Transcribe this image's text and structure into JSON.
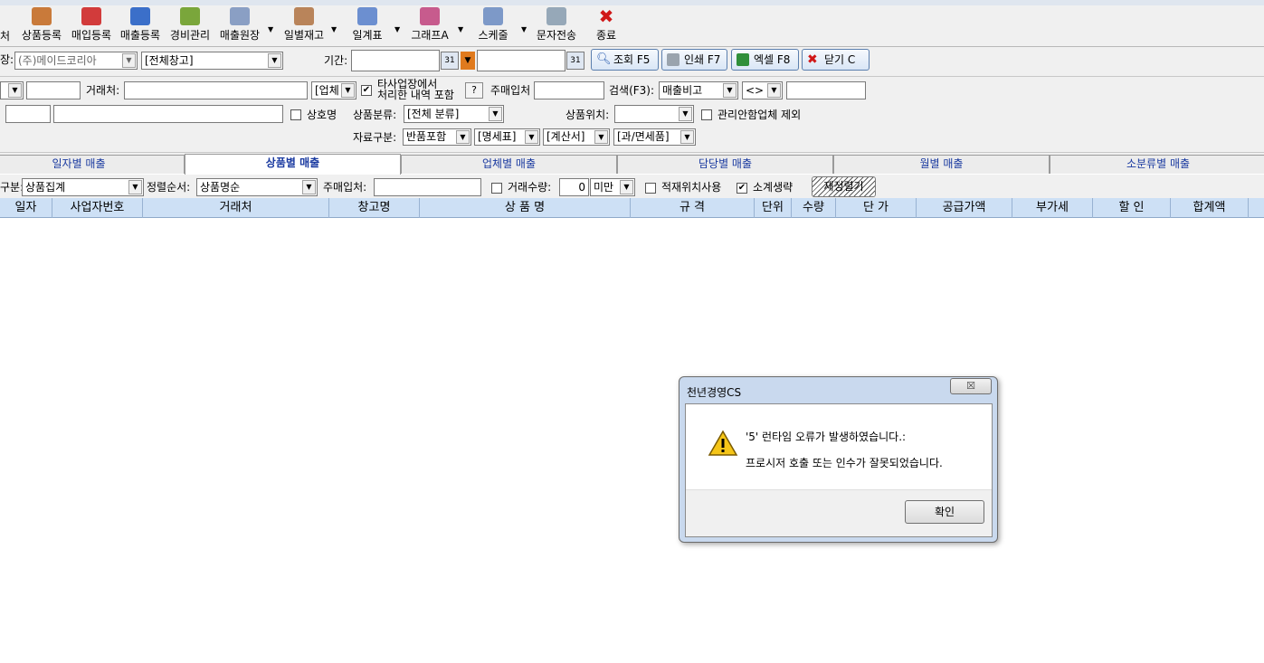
{
  "toolbar": {
    "first_label": "처",
    "items": [
      {
        "label": "상품등록",
        "icon": "box-plus-icon"
      },
      {
        "label": "매입등록",
        "icon": "purchase-icon"
      },
      {
        "label": "매출등록",
        "icon": "sales-icon"
      },
      {
        "label": "경비관리",
        "icon": "coins-icon"
      },
      {
        "label": "매출원장",
        "icon": "ledger-icon"
      },
      {
        "label": "일별재고",
        "icon": "calendar-stock-icon"
      },
      {
        "label": "일계표",
        "icon": "daily-sheet-icon"
      },
      {
        "label": "그래프A",
        "icon": "bar-graph-icon"
      },
      {
        "label": "스케줄",
        "icon": "schedule-icon"
      },
      {
        "label": "문자전송",
        "icon": "sms-icon"
      },
      {
        "label": "종료",
        "icon": "exit-x-icon"
      }
    ]
  },
  "filters": {
    "store_label": "장:",
    "store_value": "(주)메이드코리아",
    "warehouse_value": "[전체창고]",
    "period_label": "기간:",
    "search_button": "조회 F5",
    "print_button": "인쇄 F7",
    "excel_button": "엑셀 F8",
    "close_button": "닫기 C",
    "customer_label": "거래처:",
    "customer_type": "[업체",
    "other_store_line1": "타사업장에서",
    "other_store_line2": "처리한 내역 포함",
    "help_button": "?",
    "main_buyer_label": "주매입처",
    "search_label": "검색(F3):",
    "search_type": "매출비고",
    "search_op": "<>",
    "trade_name_label": "상호명",
    "category_label": "상품분류:",
    "category_value": "[전체 분류]",
    "location_label": "상품위치:",
    "exclude_label": "관리안함업체 제외",
    "data_type_label": "자료구분:",
    "data_type_1": "반품포함",
    "data_type_2": "[명세표]",
    "data_type_3": "[계산서]",
    "data_type_4": "[과/면세품]"
  },
  "tabs": [
    {
      "label": "일자별 매출",
      "active": false
    },
    {
      "label": "상품별 매출",
      "active": true
    },
    {
      "label": "업체별 매출",
      "active": false
    },
    {
      "label": "담당별 매출",
      "active": false
    },
    {
      "label": "월별 매출",
      "active": false
    },
    {
      "label": "소분류별 매출",
      "active": false
    }
  ],
  "subbar": {
    "group_label": "구분:",
    "group_value": "상품집계",
    "sort_label": "정렬순서:",
    "sort_value": "상품명순",
    "main_buyer_label": "주매입처:",
    "qty_label": "거래수량:",
    "qty_value": "0",
    "qty_op": "미만",
    "location_use_label": "적재위치사용",
    "subtotal_label": "소계생략",
    "subtotal_checked": true,
    "rearrange_button": "재정렬기"
  },
  "grid": {
    "columns": [
      "일자",
      "사업자번호",
      "거래처",
      "창고명",
      "상 품 명",
      "규 격",
      "단위",
      "수량",
      "단 가",
      "공급가액",
      "부가세",
      "할 인",
      "합계액"
    ]
  },
  "dialog": {
    "title": "천년경영CS",
    "close_glyph": "☒",
    "message_line1": "'5' 런타임 오류가 발생하였습니다.:",
    "message_line2": "프로시저 호출 또는 인수가 잘못되었습니다.",
    "ok_label": "확인",
    "icon": "warning-icon"
  },
  "colors": {
    "header_bg": "#cde0f5",
    "tab_text": "#1a3aa0",
    "dialog_frame": "#c9d9ee"
  }
}
